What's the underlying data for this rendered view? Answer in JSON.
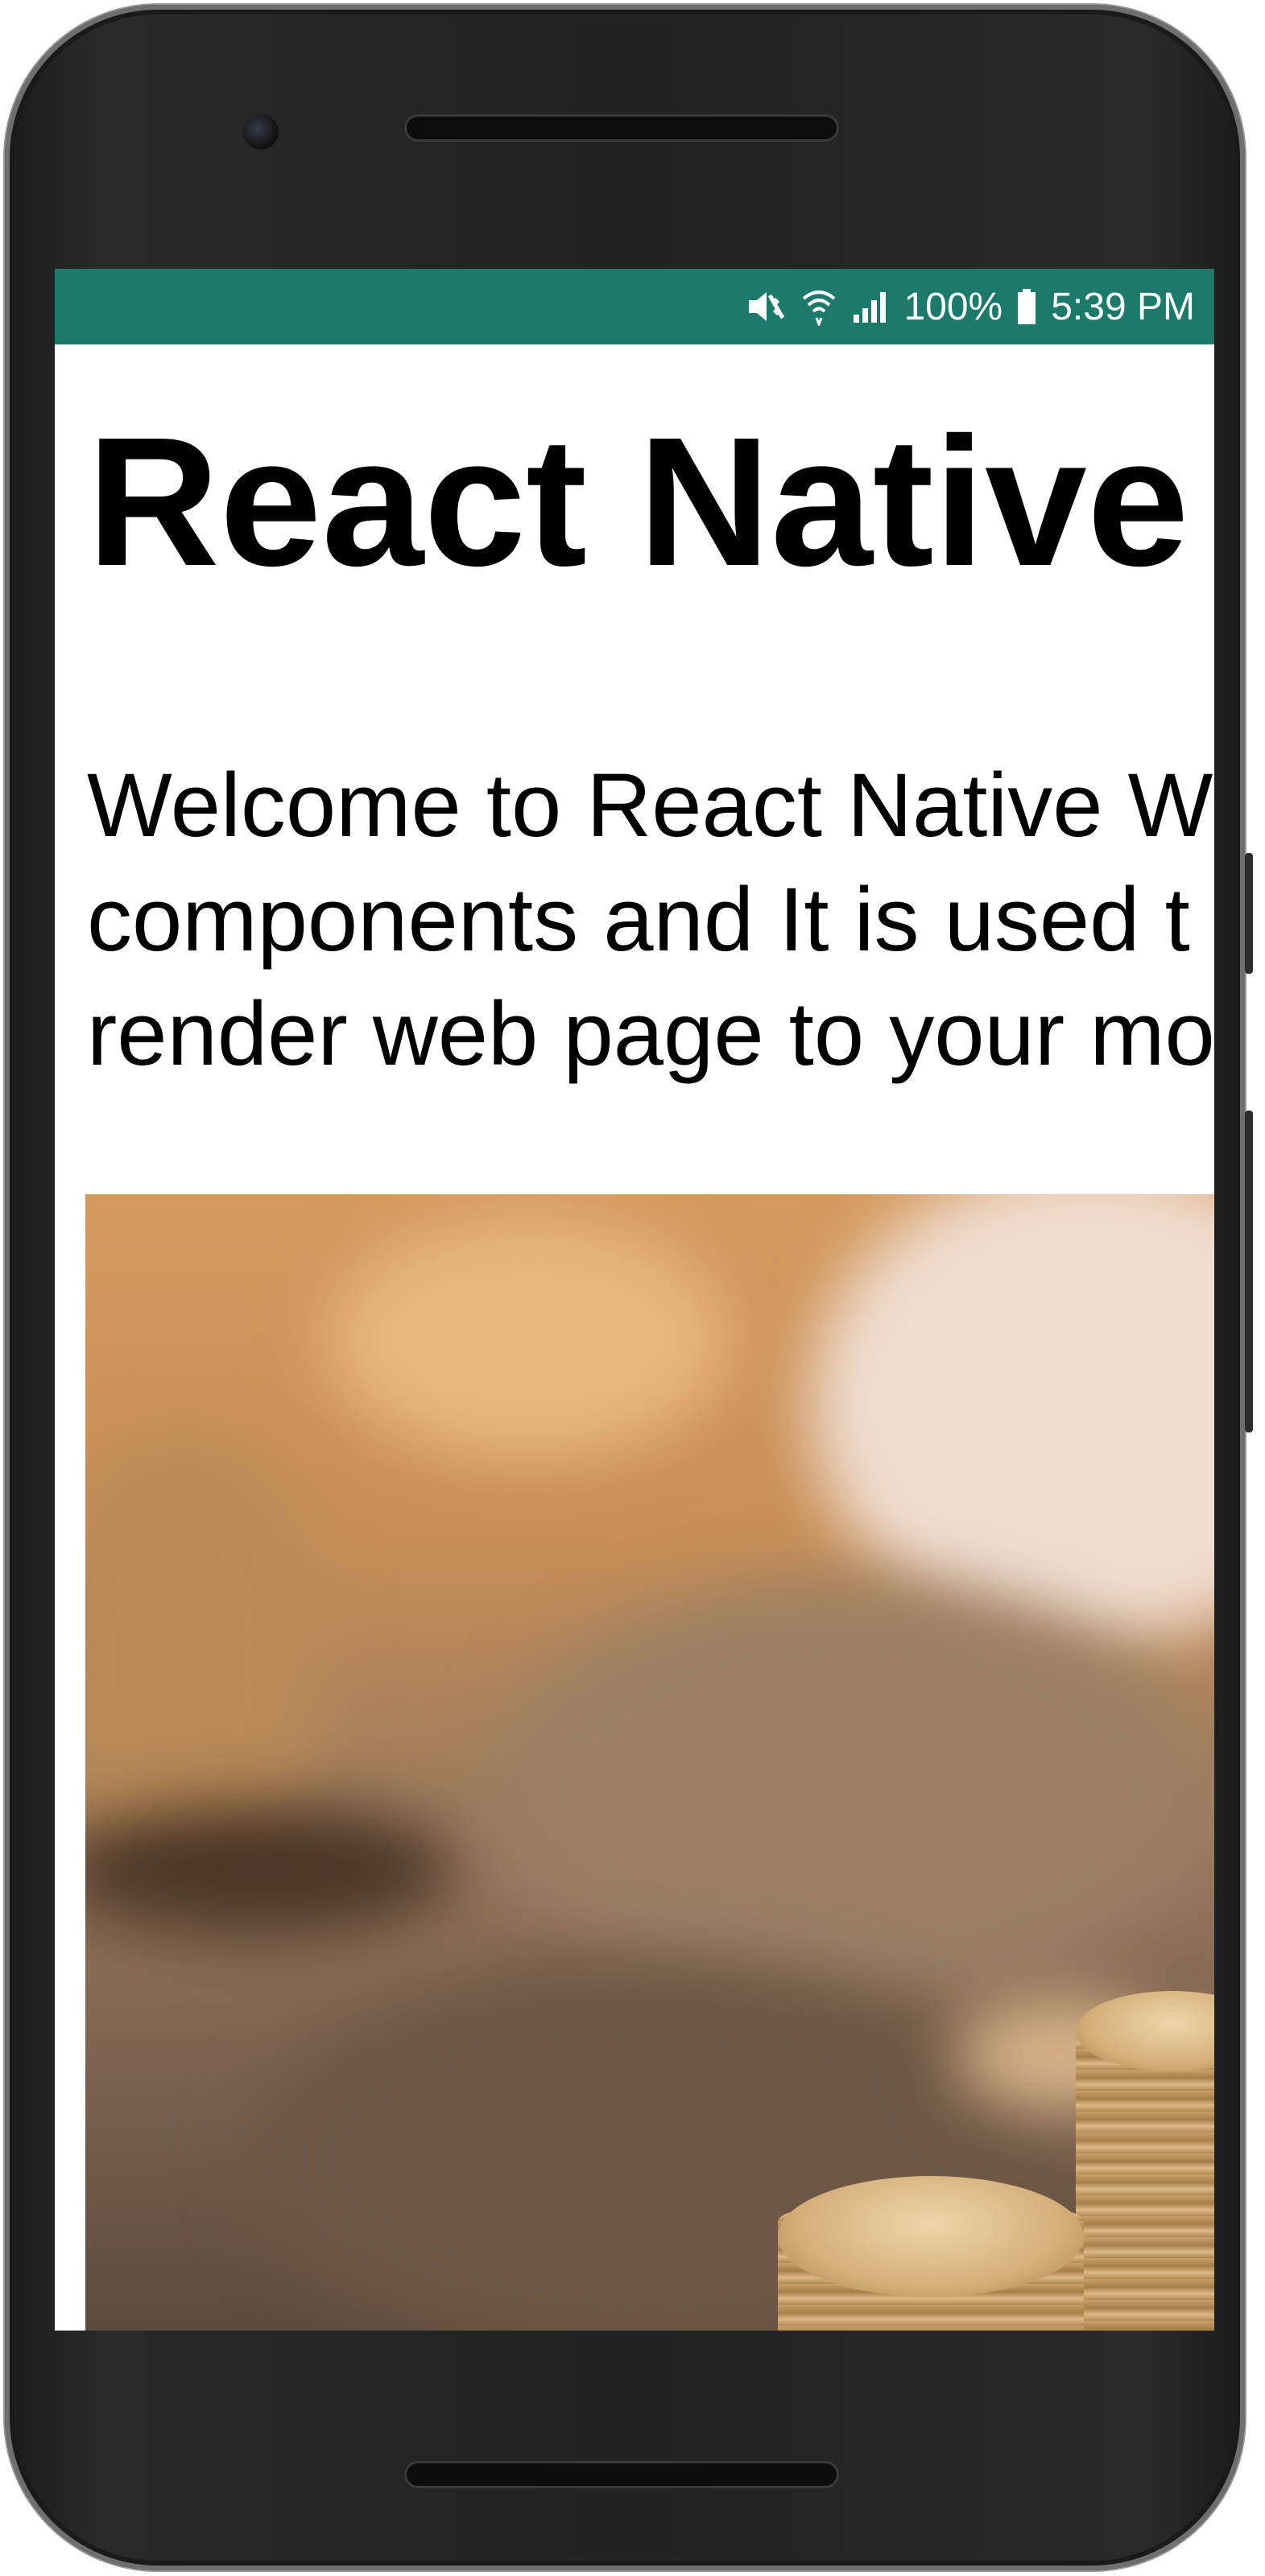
{
  "status_bar": {
    "icons": [
      "mute-vibrate-icon",
      "wifi-icon",
      "signal-icon",
      "battery-icon"
    ],
    "battery_percent": "100%",
    "time": "5:39 PM",
    "color": "#1b7a6a"
  },
  "content": {
    "title": "React Native",
    "body_lines": [
      "Welcome to React Native W",
      "components and It is used t",
      "render web page to your mo"
    ],
    "image_description_visible": false
  },
  "colors": {
    "status_bar_bg": "#1b7a6a",
    "content_bg": "#ffffff",
    "text": "#000000",
    "device_frame": "#222222"
  }
}
